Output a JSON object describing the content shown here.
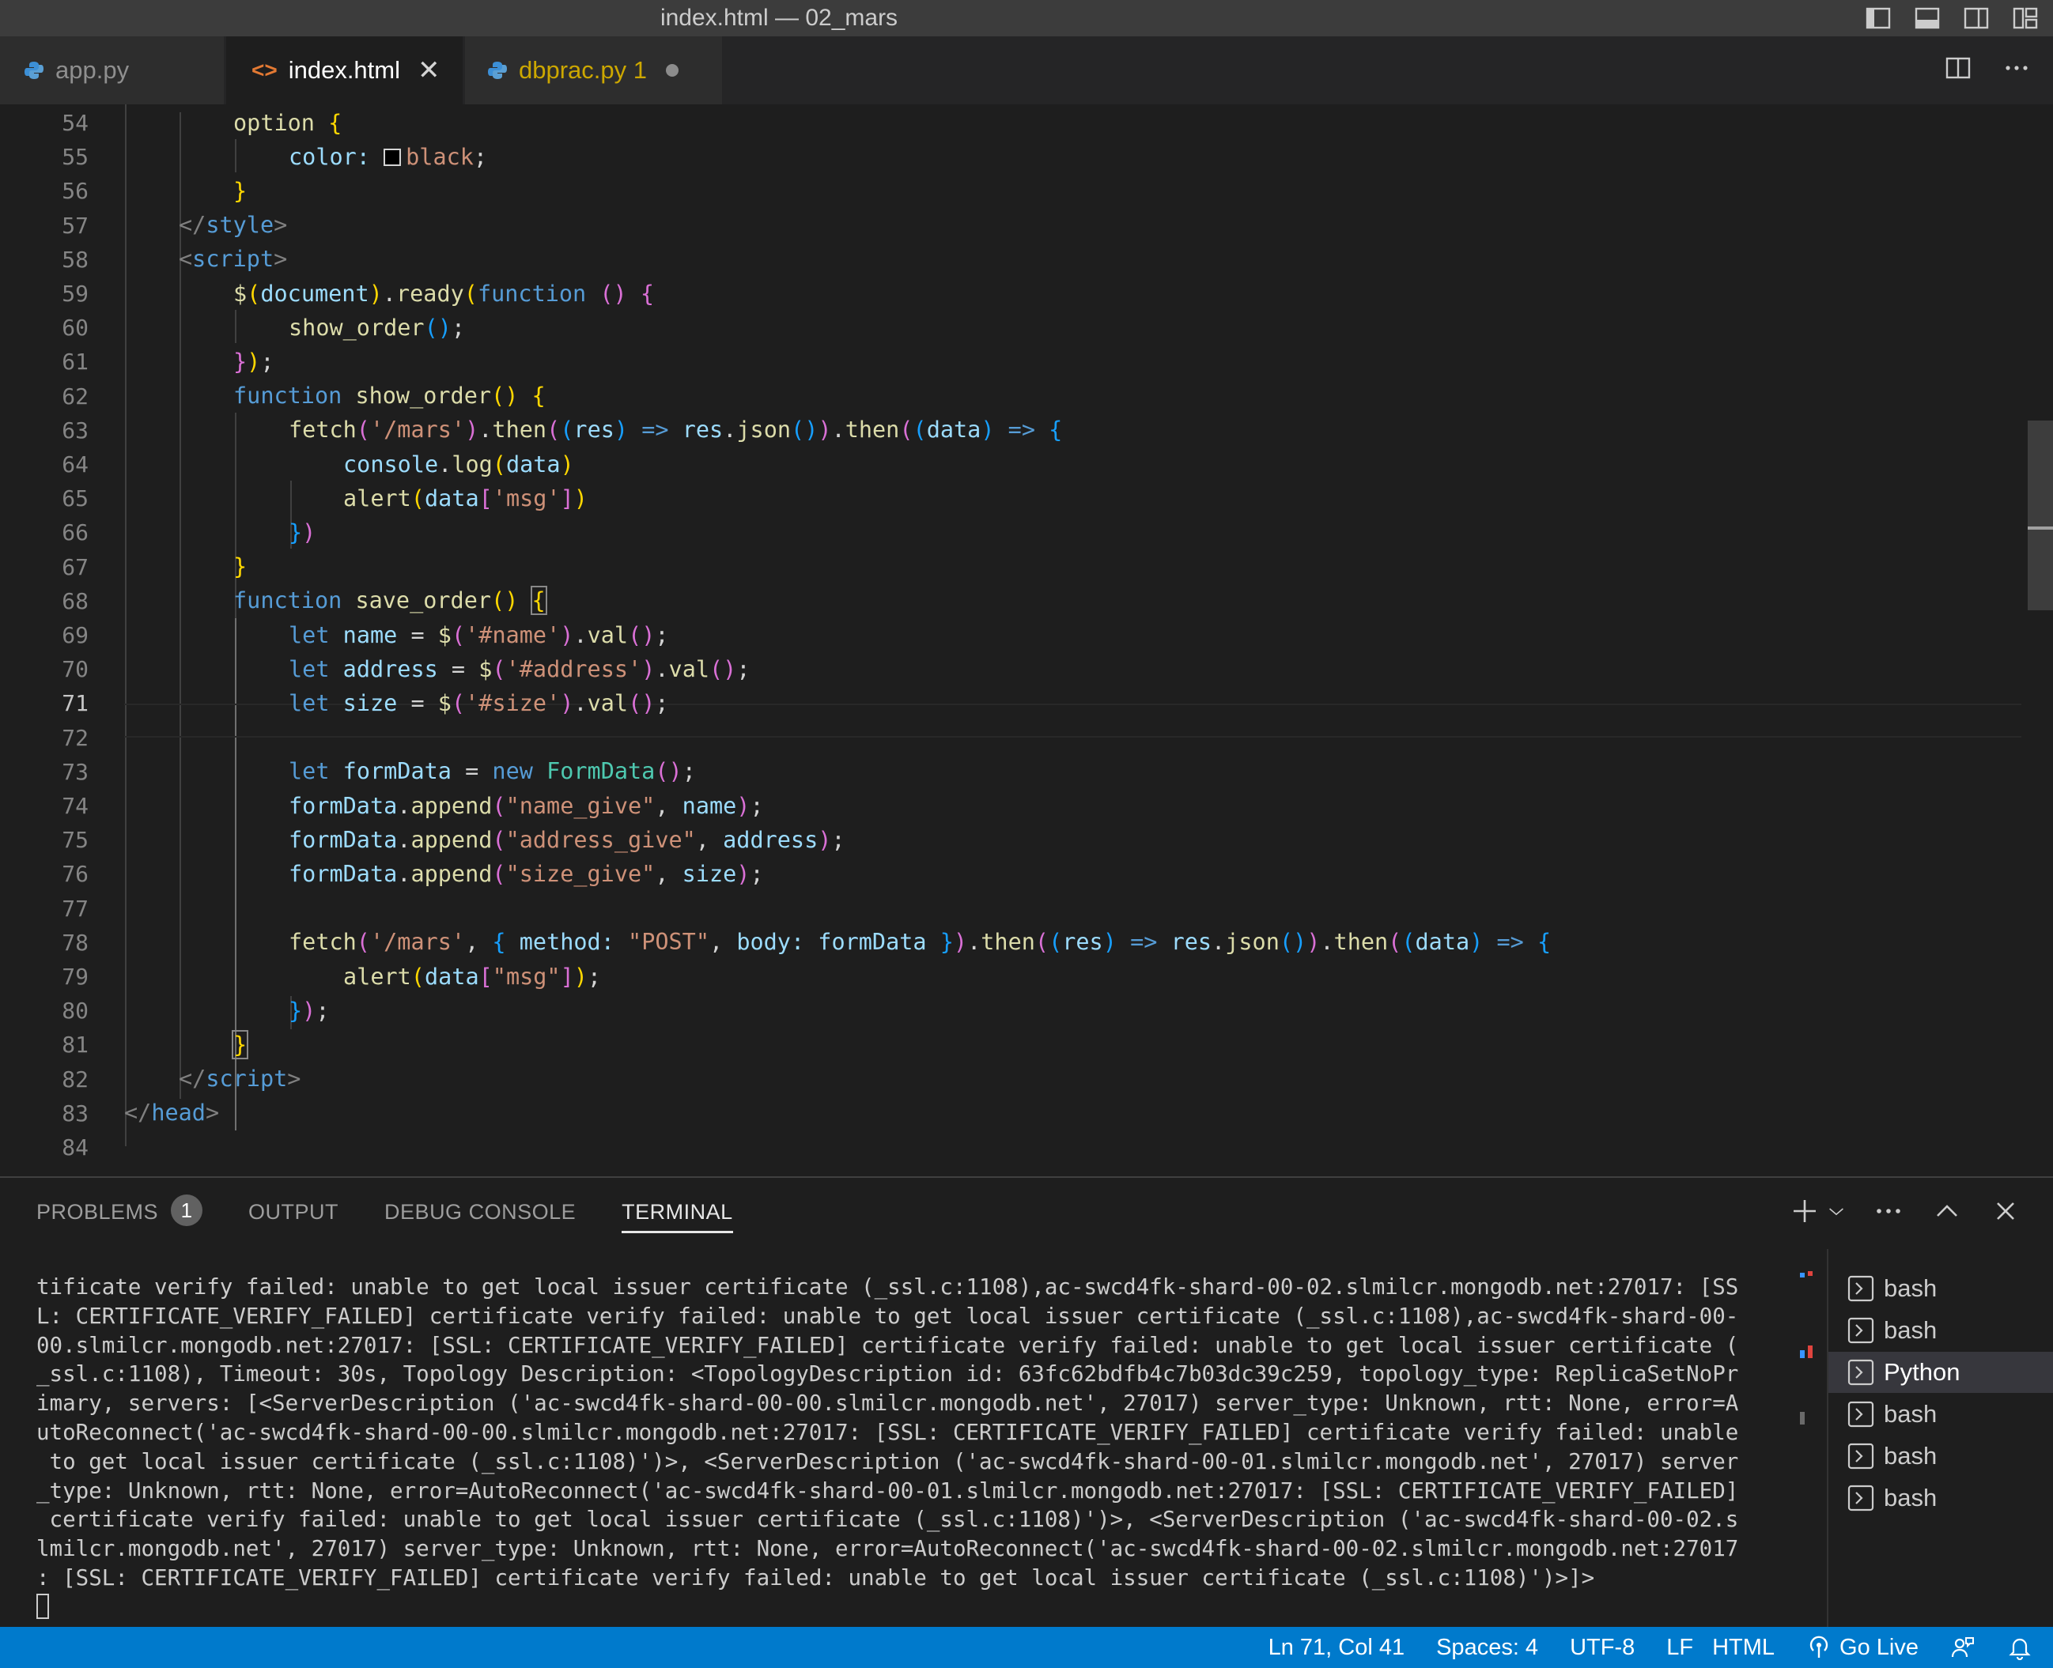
{
  "window": {
    "title": "index.html — 02_mars"
  },
  "tabs": [
    {
      "label": "app.py",
      "icon": "python-file-icon",
      "active": false
    },
    {
      "label": "index.html",
      "icon": "html-file-icon",
      "active": true
    },
    {
      "label": "dbprac.py 1",
      "icon": "python-file-icon",
      "active": false,
      "modified": true
    }
  ],
  "editor": {
    "current_line": 71,
    "line_numbers": [
      "54",
      "55",
      "56",
      "57",
      "58",
      "59",
      "60",
      "61",
      "62",
      "63",
      "64",
      "65",
      "66",
      "67",
      "68",
      "69",
      "70",
      "71",
      "72",
      "73",
      "74",
      "75",
      "76",
      "77",
      "78",
      "79",
      "80",
      "81",
      "82",
      "83",
      "84"
    ],
    "code_text": {
      "l54_option": "option",
      "l55_color": "color:",
      "l55_black": "black",
      "l63_str": "'/mars'",
      "l65_str": "'msg'",
      "l69_str": "'#name'",
      "l70_str": "'#address'",
      "l71_str": "'#size'",
      "l74_str": "\"name_give\"",
      "l75_str": "\"address_give\"",
      "l76_str": "\"size_give\"",
      "l78_str1": "'/mars'",
      "l78_str2": "\"POST\"",
      "l79_str": "\"msg\""
    }
  },
  "panel": {
    "tabs": [
      {
        "label": "PROBLEMS",
        "badge": "1"
      },
      {
        "label": "OUTPUT"
      },
      {
        "label": "DEBUG CONSOLE"
      },
      {
        "label": "TERMINAL",
        "active": true
      }
    ],
    "terminal_lines": [
      "tificate verify failed: unable to get local issuer certificate (_ssl.c:1108),ac-swcd4fk-shard-00-02.slmilcr.mongodb.net:27017: [SS",
      "L: CERTIFICATE_VERIFY_FAILED] certificate verify failed: unable to get local issuer certificate (_ssl.c:1108),ac-swcd4fk-shard-00-",
      "00.slmilcr.mongodb.net:27017: [SSL: CERTIFICATE_VERIFY_FAILED] certificate verify failed: unable to get local issuer certificate (",
      "_ssl.c:1108), Timeout: 30s, Topology Description: <TopologyDescription id: 63fc62bdfb4c7b03dc39c259, topology_type: ReplicaSetNoPr",
      "imary, servers: [<ServerDescription ('ac-swcd4fk-shard-00-00.slmilcr.mongodb.net', 27017) server_type: Unknown, rtt: None, error=A",
      "utoReconnect('ac-swcd4fk-shard-00-00.slmilcr.mongodb.net:27017: [SSL: CERTIFICATE_VERIFY_FAILED] certificate verify failed: unable",
      " to get local issuer certificate (_ssl.c:1108)')>, <ServerDescription ('ac-swcd4fk-shard-00-01.slmilcr.mongodb.net', 27017) server",
      "_type: Unknown, rtt: None, error=AutoReconnect('ac-swcd4fk-shard-00-01.slmilcr.mongodb.net:27017: [SSL: CERTIFICATE_VERIFY_FAILED]",
      " certificate verify failed: unable to get local issuer certificate (_ssl.c:1108)')>, <ServerDescription ('ac-swcd4fk-shard-00-02.s",
      "lmilcr.mongodb.net', 27017) server_type: Unknown, rtt: None, error=AutoReconnect('ac-swcd4fk-shard-00-02.slmilcr.mongodb.net:27017",
      ": [SSL: CERTIFICATE_VERIFY_FAILED] certificate verify failed: unable to get local issuer certificate (_ssl.c:1108)')>]>"
    ],
    "terminals": [
      {
        "label": "bash"
      },
      {
        "label": "bash"
      },
      {
        "label": "Python",
        "active": true
      },
      {
        "label": "bash"
      },
      {
        "label": "bash"
      },
      {
        "label": "bash"
      }
    ]
  },
  "statusbar": {
    "position": "Ln 71, Col 41",
    "spaces": "Spaces: 4",
    "encoding": "UTF-8",
    "eol": "LF",
    "language": "HTML",
    "golive": "Go Live"
  },
  "colors": {
    "statusbar": "#007acc",
    "editor_bg": "#1e1e1e",
    "titlebar": "#3c3c3c"
  }
}
